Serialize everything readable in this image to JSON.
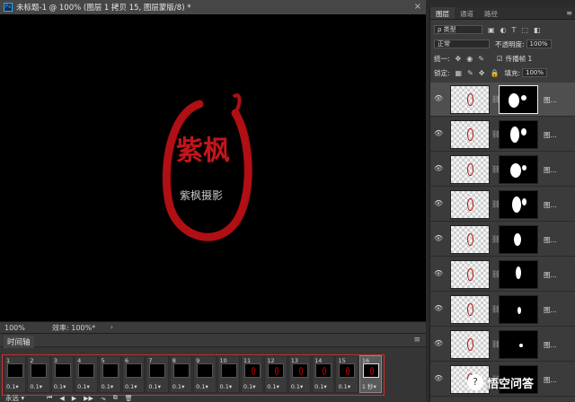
{
  "document": {
    "app_icon": "Ps",
    "title": "未标题-1 @ 100% (图层 1 拷贝 15, 图层蒙版/8) *",
    "close": "×"
  },
  "canvas": {
    "logo_big": "紫枫",
    "logo_small": "紫枫摄影",
    "logo_color": "#b00f14"
  },
  "status": {
    "zoom": "100%",
    "efficiency": "效率: 100%*",
    "arrow": "›"
  },
  "timeline": {
    "tab": "时间轴",
    "menu": "≡",
    "frames": [
      {
        "num": "1",
        "delay": "0.1"
      },
      {
        "num": "2",
        "delay": "0.1"
      },
      {
        "num": "3",
        "delay": "0.1"
      },
      {
        "num": "4",
        "delay": "0.1"
      },
      {
        "num": "5",
        "delay": "0.1"
      },
      {
        "num": "6",
        "delay": "0.1"
      },
      {
        "num": "7",
        "delay": "0.1"
      },
      {
        "num": "8",
        "delay": "0.1"
      },
      {
        "num": "9",
        "delay": "0.1"
      },
      {
        "num": "10",
        "delay": "0.1"
      },
      {
        "num": "11",
        "delay": "0.1"
      },
      {
        "num": "12",
        "delay": "0.1"
      },
      {
        "num": "13",
        "delay": "0.1"
      },
      {
        "num": "14",
        "delay": "0.1"
      },
      {
        "num": "15",
        "delay": "0.1"
      },
      {
        "num": "16",
        "delay": "1 秒"
      }
    ],
    "selected_frame": 16,
    "loop": "永远",
    "controls": [
      "⏮",
      "◀",
      "▶",
      "▶▶",
      "⬎",
      "⧉",
      "🗑"
    ]
  },
  "panel": {
    "tabs": [
      "图层",
      "通道",
      "路径"
    ],
    "menu": "≡",
    "filter": "ρ 类型",
    "blend_mode": "正常",
    "opacity_label": "不透明度:",
    "opacity": "100%",
    "unify_label": "统一:",
    "propagate_label": "传播帧 1",
    "lock_label": "锁定:",
    "fill_label": "填充:",
    "fill": "100%",
    "layers": [
      {
        "name": "图..."
      },
      {
        "name": "图..."
      },
      {
        "name": "图..."
      },
      {
        "name": "图..."
      },
      {
        "name": "图..."
      },
      {
        "name": "图..."
      },
      {
        "name": "图..."
      },
      {
        "name": "图..."
      },
      {
        "name": "图..."
      }
    ]
  },
  "watermark": {
    "icon": "?",
    "text": "悟空问答"
  }
}
